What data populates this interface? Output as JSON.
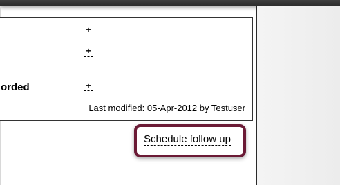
{
  "record": {
    "add_buttons": [
      "+",
      "+",
      "+"
    ],
    "field_label": "orded",
    "last_modified_text": "Last modified: 05-Apr-2012 by Testuser"
  },
  "actions": {
    "schedule_follow_up_label": "Schedule follow up"
  },
  "colors": {
    "highlight_border": "#6b1a35",
    "top_bar": "#333333",
    "panel_bg": "#efefef"
  }
}
